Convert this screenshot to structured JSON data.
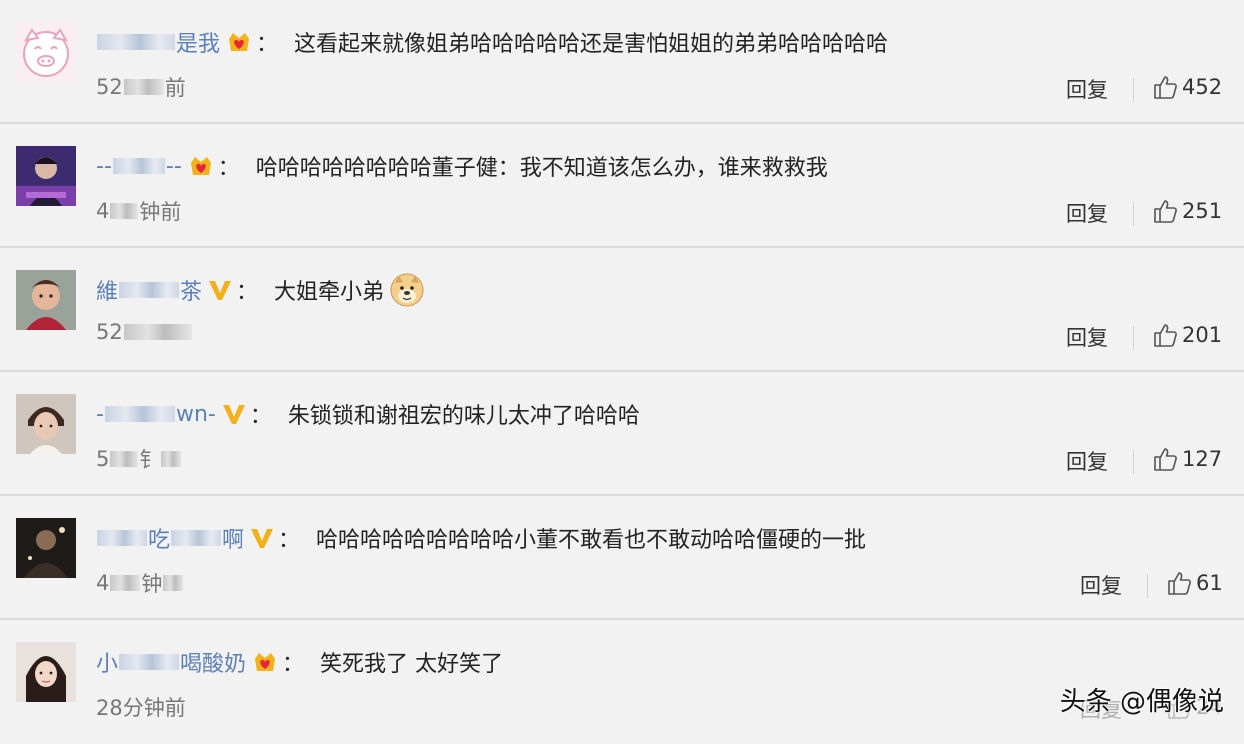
{
  "comments": [
    {
      "username": "是我",
      "badge": "crown-heart",
      "text": "这看起来就像姐弟哈哈哈哈哈还是害怕姐姐的弟弟哈哈哈哈哈",
      "time": "52",
      "time_tail": "前",
      "reply": "回复",
      "likes": "452"
    },
    {
      "username": "--",
      "username_tail": "--",
      "badge": "crown-heart",
      "text": "哈哈哈哈哈哈哈哈董子健：我不知道该怎么办，谁来救救我",
      "time": "4",
      "time_tail": "钟前",
      "reply": "回复",
      "likes": "251"
    },
    {
      "username": "維",
      "username_tail": "茶",
      "badge": "v-gold",
      "text": "大姐牵小弟",
      "time": "52",
      "time_tail": "",
      "reply": "回复",
      "likes": "201"
    },
    {
      "username": "-",
      "username_tail": "wn-",
      "badge": "v-gold",
      "text": "朱锁锁和谢祖宏的味儿太冲了哈哈哈",
      "time": "5",
      "time_tail": "钅",
      "reply": "回复",
      "likes": "127"
    },
    {
      "username": "",
      "username_mid": "吃",
      "username_tail": "啊",
      "badge": "v-gold",
      "text": "哈哈哈哈哈哈哈哈哈小董不敢看也不敢动哈哈僵硬的一批",
      "time": "4",
      "time_tail": "钟",
      "reply": "回复",
      "likes": "61"
    },
    {
      "username": "小",
      "username_tail": "喝酸奶",
      "badge": "crown-heart",
      "text": "笑死我了 太好笑了",
      "time": "28分钟前",
      "time_tail": "",
      "reply": "回复",
      "likes": "24"
    }
  ],
  "watermark": "头条 @偶像说",
  "colors": {
    "username": "#5b7fb8",
    "background": "#f2f2f2",
    "text": "#222222",
    "time": "#777777"
  }
}
